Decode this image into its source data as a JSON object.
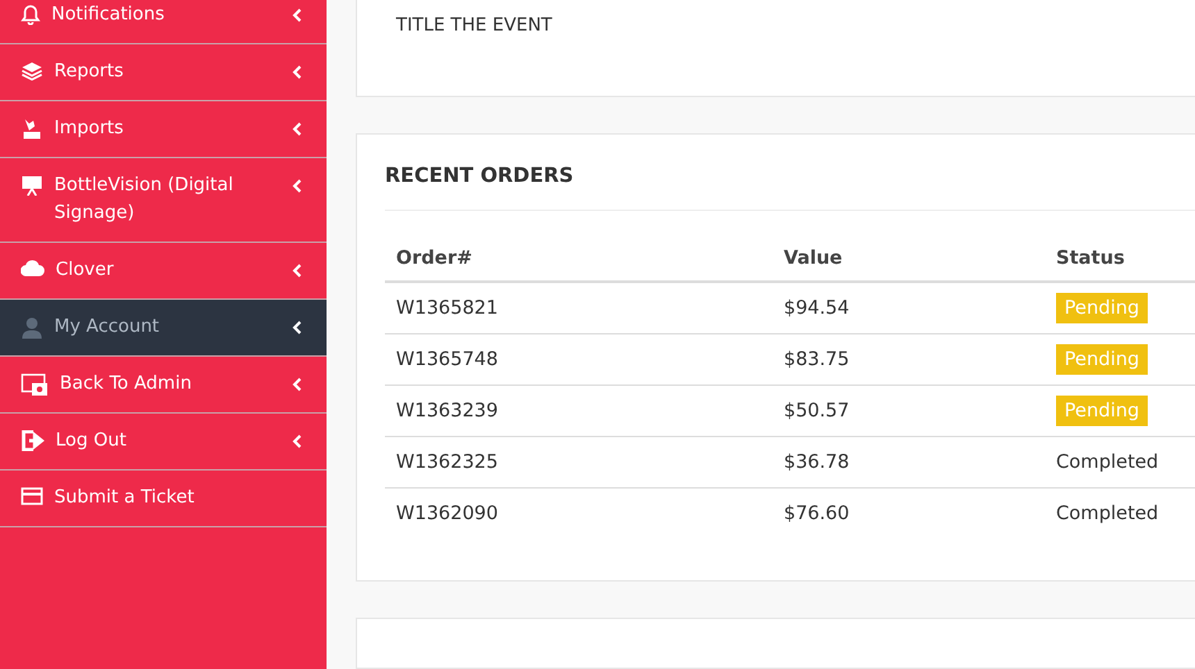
{
  "sidebar": {
    "items": [
      {
        "label": "Notifications",
        "selected": false,
        "chevron": true
      },
      {
        "label": "Reports",
        "selected": false,
        "chevron": true
      },
      {
        "label": "Imports",
        "selected": false,
        "chevron": true
      },
      {
        "label": "BottleVision (Digital Signage)",
        "selected": false,
        "chevron": true
      },
      {
        "label": "Clover",
        "selected": false,
        "chevron": true
      },
      {
        "label": "My Account",
        "selected": true,
        "chevron": true
      },
      {
        "label": "Back To Admin",
        "selected": false,
        "chevron": true
      },
      {
        "label": "Log Out",
        "selected": false,
        "chevron": true
      },
      {
        "label": "Submit a Ticket",
        "selected": false,
        "chevron": false
      }
    ]
  },
  "event_card": {
    "text": "TITLE THE EVENT"
  },
  "recent_orders": {
    "title": "RECENT ORDERS",
    "columns": [
      "Order#",
      "Value",
      "Status"
    ],
    "rows": [
      {
        "order": "W1365821",
        "value": "$94.54",
        "status": {
          "label": "Pending",
          "kind": "badge"
        }
      },
      {
        "order": "W1365748",
        "value": "$83.75",
        "status": {
          "label": "Pending",
          "kind": "badge"
        }
      },
      {
        "order": "W1363239",
        "value": "$50.57",
        "status": {
          "label": "Pending",
          "kind": "badge"
        }
      },
      {
        "order": "W1362325",
        "value": "$36.78",
        "status": {
          "label": "Completed",
          "kind": "text"
        }
      },
      {
        "order": "W1362090",
        "value": "$76.60",
        "status": {
          "label": "Completed",
          "kind": "text"
        }
      }
    ]
  }
}
